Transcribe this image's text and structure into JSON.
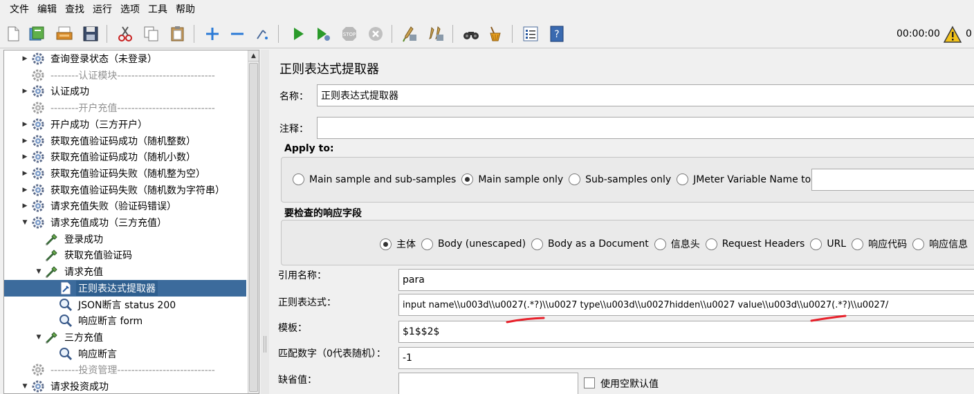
{
  "menu": [
    "文件",
    "编辑",
    "查找",
    "运行",
    "选项",
    "工具",
    "帮助"
  ],
  "toolbar": {
    "buttons": [
      "new-icon",
      "templates-icon",
      "open-icon",
      "save-icon",
      "cut-icon",
      "copy-icon",
      "paste-icon",
      "expand-icon",
      "collapse-icon",
      "toggle-icon",
      "start-icon",
      "start-no-pause-icon",
      "stop-icon",
      "shutdown-icon",
      "clear-icon",
      "clear-all-icon",
      "search-icon",
      "reset-search-icon",
      "function-helper-icon",
      "help-icon"
    ],
    "timer": "00:00:00",
    "warning_count": "0"
  },
  "tree": {
    "items": [
      {
        "label": "查询登录状态（未登录）",
        "type": "thread",
        "indent": 0,
        "toggle": "collapsed"
      },
      {
        "label": "--------认证模块----------------------------",
        "type": "separator",
        "indent": 0,
        "toggle": "none"
      },
      {
        "label": "认证成功",
        "type": "thread",
        "indent": 0,
        "toggle": "collapsed"
      },
      {
        "label": "--------开户充值----------------------------",
        "type": "separator",
        "indent": 0,
        "toggle": "none"
      },
      {
        "label": "开户成功（三方开户）",
        "type": "thread",
        "indent": 0,
        "toggle": "collapsed"
      },
      {
        "label": "获取充值验证码成功（随机整数）",
        "type": "thread",
        "indent": 0,
        "toggle": "collapsed"
      },
      {
        "label": "获取充值验证码成功（随机小数）",
        "type": "thread",
        "indent": 0,
        "toggle": "collapsed"
      },
      {
        "label": "获取充值验证码失败（随机整为空）",
        "type": "thread",
        "indent": 0,
        "toggle": "collapsed"
      },
      {
        "label": "获取充值验证码失败（随机数为字符串）",
        "type": "thread",
        "indent": 0,
        "toggle": "collapsed"
      },
      {
        "label": "请求充值失败（验证码错误）",
        "type": "thread",
        "indent": 0,
        "toggle": "collapsed"
      },
      {
        "label": "请求充值成功（三方充值）",
        "type": "thread",
        "indent": 0,
        "toggle": "expanded"
      },
      {
        "label": "登录成功",
        "type": "sampler",
        "indent": 1,
        "toggle": "none"
      },
      {
        "label": "获取充值验证码",
        "type": "sampler",
        "indent": 1,
        "toggle": "none"
      },
      {
        "label": "请求充值",
        "type": "sampler",
        "indent": 1,
        "toggle": "expanded"
      },
      {
        "label": "正则表达式提取器",
        "type": "extractor",
        "indent": 2,
        "toggle": "none",
        "selected": true
      },
      {
        "label": "JSON断言 status 200",
        "type": "assertion",
        "indent": 2,
        "toggle": "none"
      },
      {
        "label": "响应断言 form",
        "type": "assertion",
        "indent": 2,
        "toggle": "none"
      },
      {
        "label": "三方充值",
        "type": "sampler",
        "indent": 1,
        "toggle": "expanded"
      },
      {
        "label": "响应断言",
        "type": "assertion",
        "indent": 2,
        "toggle": "none"
      },
      {
        "label": "--------投资管理----------------------------",
        "type": "separator",
        "indent": 0,
        "toggle": "none"
      },
      {
        "label": "请求投资成功",
        "type": "thread",
        "indent": 0,
        "toggle": "expanded"
      }
    ]
  },
  "form": {
    "title": "正则表达式提取器",
    "name_label": "名称：",
    "name_value": "正则表达式提取器",
    "comment_label": "注释：",
    "comment_value": "",
    "apply_to": {
      "title": "Apply to:",
      "options": [
        "Main sample and sub-samples",
        "Main sample only",
        "Sub-samples only",
        "JMeter Variable Name to use"
      ],
      "selected": 1,
      "variable_value": ""
    },
    "field_to_check": {
      "title": "要检查的响应字段",
      "options": [
        "主体",
        "Body (unescaped)",
        "Body as a Document",
        "信息头",
        "Request Headers",
        "URL",
        "响应代码",
        "响应信息"
      ],
      "selected": 0
    },
    "ref_name_label": "引用名称：",
    "ref_name_value": "para",
    "regex_label": "正则表达式：",
    "regex_value": "input name\\\\u003d\\\\u0027(.*?)\\\\u0027 type\\\\u003d\\\\u0027hidden\\\\u0027 value\\\\u003d\\\\u0027(.*?)\\\\u0027/",
    "template_label": "模板：",
    "template_value": "$1$$2$",
    "match_no_label": "匹配数字（0代表随机）：",
    "match_no_value": "-1",
    "default_label": "缺省值：",
    "default_value": "",
    "use_empty_default_label": "使用空默认值"
  },
  "colors": {
    "selection": "#2f5f8f",
    "annotation": "#e8202a"
  }
}
